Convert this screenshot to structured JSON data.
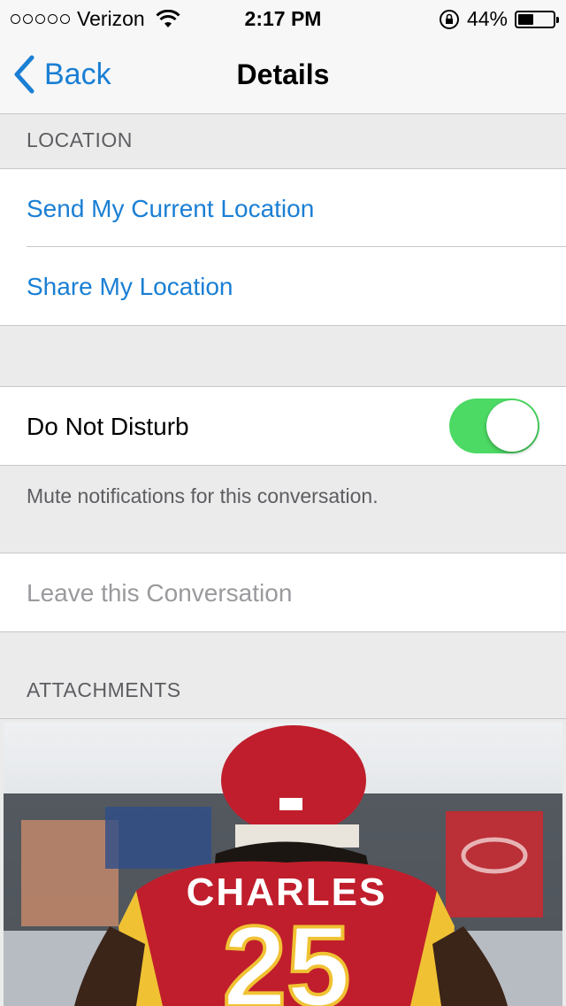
{
  "status_bar": {
    "carrier": "Verizon",
    "time": "2:17 PM",
    "battery_percent": "44%",
    "battery_level": 0.44,
    "signal_dots": 5
  },
  "nav": {
    "back_label": "Back",
    "title": "Details"
  },
  "location": {
    "header": "LOCATION",
    "send_current": "Send My Current Location",
    "share": "Share My Location"
  },
  "dnd": {
    "label": "Do Not Disturb",
    "enabled": true,
    "footer": "Mute notifications for this conversation."
  },
  "leave": {
    "label": "Leave this Conversation"
  },
  "attachments": {
    "header": "ATTACHMENTS",
    "image_text": "CHARLES",
    "image_number": "25"
  },
  "colors": {
    "accent": "#1a7fd4",
    "toggle_on": "#4cd964",
    "background": "#ebebeb"
  }
}
